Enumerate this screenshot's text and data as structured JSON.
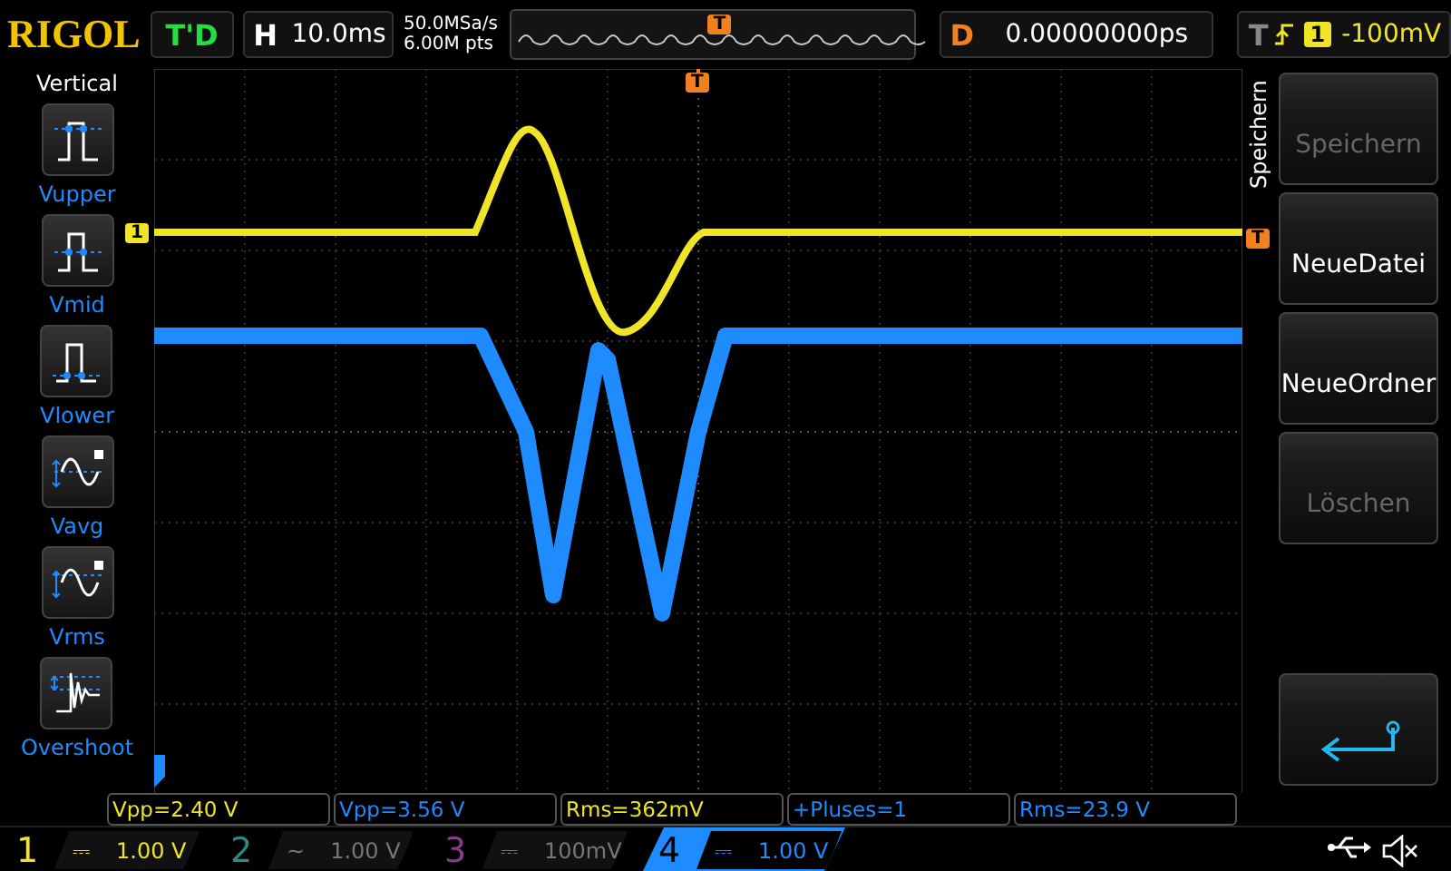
{
  "brand": "RIGOL",
  "run_status": "T'D",
  "timebase": {
    "label": "H",
    "value": "10.0ms"
  },
  "acquisition": {
    "sample_rate": "50.0MSa/s",
    "memory_depth": "6.00M pts"
  },
  "delay": {
    "label": "D",
    "value": "0.00000000ps"
  },
  "trigger": {
    "label": "T",
    "source": "1",
    "level": "-100mV"
  },
  "left_menu": {
    "title": "Vertical",
    "items": [
      {
        "label": "Vupper",
        "kind": "upper"
      },
      {
        "label": "Vmid",
        "kind": "mid"
      },
      {
        "label": "Vlower",
        "kind": "lower"
      },
      {
        "label": "Vavg",
        "kind": "avg"
      },
      {
        "label": "Vrms",
        "kind": "rms"
      },
      {
        "label": "Overshoot",
        "kind": "overshoot"
      }
    ]
  },
  "overview": {
    "trigger_position_marker": "T"
  },
  "screen": {
    "channel_marker": "1",
    "trigger_position_marker": "T",
    "trigger_level_marker": "T"
  },
  "right_menu": {
    "title": "Speichern",
    "buttons": [
      {
        "label": "Speichern",
        "disabled": true
      },
      {
        "label": "NeueDatei",
        "disabled": false
      },
      {
        "label": "NeueOrdner",
        "disabled": false
      },
      {
        "label": "Löschen",
        "disabled": true
      }
    ]
  },
  "measurements": [
    {
      "text": "Vpp=2.40 V",
      "color": "#f0e428"
    },
    {
      "text": "Vpp=3.56 V",
      "color": "#1e8cff"
    },
    {
      "text": "Rms=362mV",
      "color": "#f0e428"
    },
    {
      "text": "+Pluses=1",
      "color": "#1e8cff"
    },
    {
      "text": "Rms=23.9 V",
      "color": "#1e8cff"
    }
  ],
  "channels": [
    {
      "number": "1",
      "coupling": "⎓",
      "scale": "1.00 V",
      "on": true,
      "selected": false,
      "color": "#f0e428"
    },
    {
      "number": "2",
      "coupling": "~",
      "scale": "1.00 V",
      "on": false,
      "selected": false,
      "color": "#2a8a84"
    },
    {
      "number": "3",
      "coupling": "⎓",
      "scale": "100mV",
      "on": false,
      "selected": false,
      "color": "#8a3a8a"
    },
    {
      "number": "4",
      "coupling": "⎓",
      "scale": "1.00 V",
      "on": true,
      "selected": true,
      "color": "#1e8cff"
    }
  ]
}
